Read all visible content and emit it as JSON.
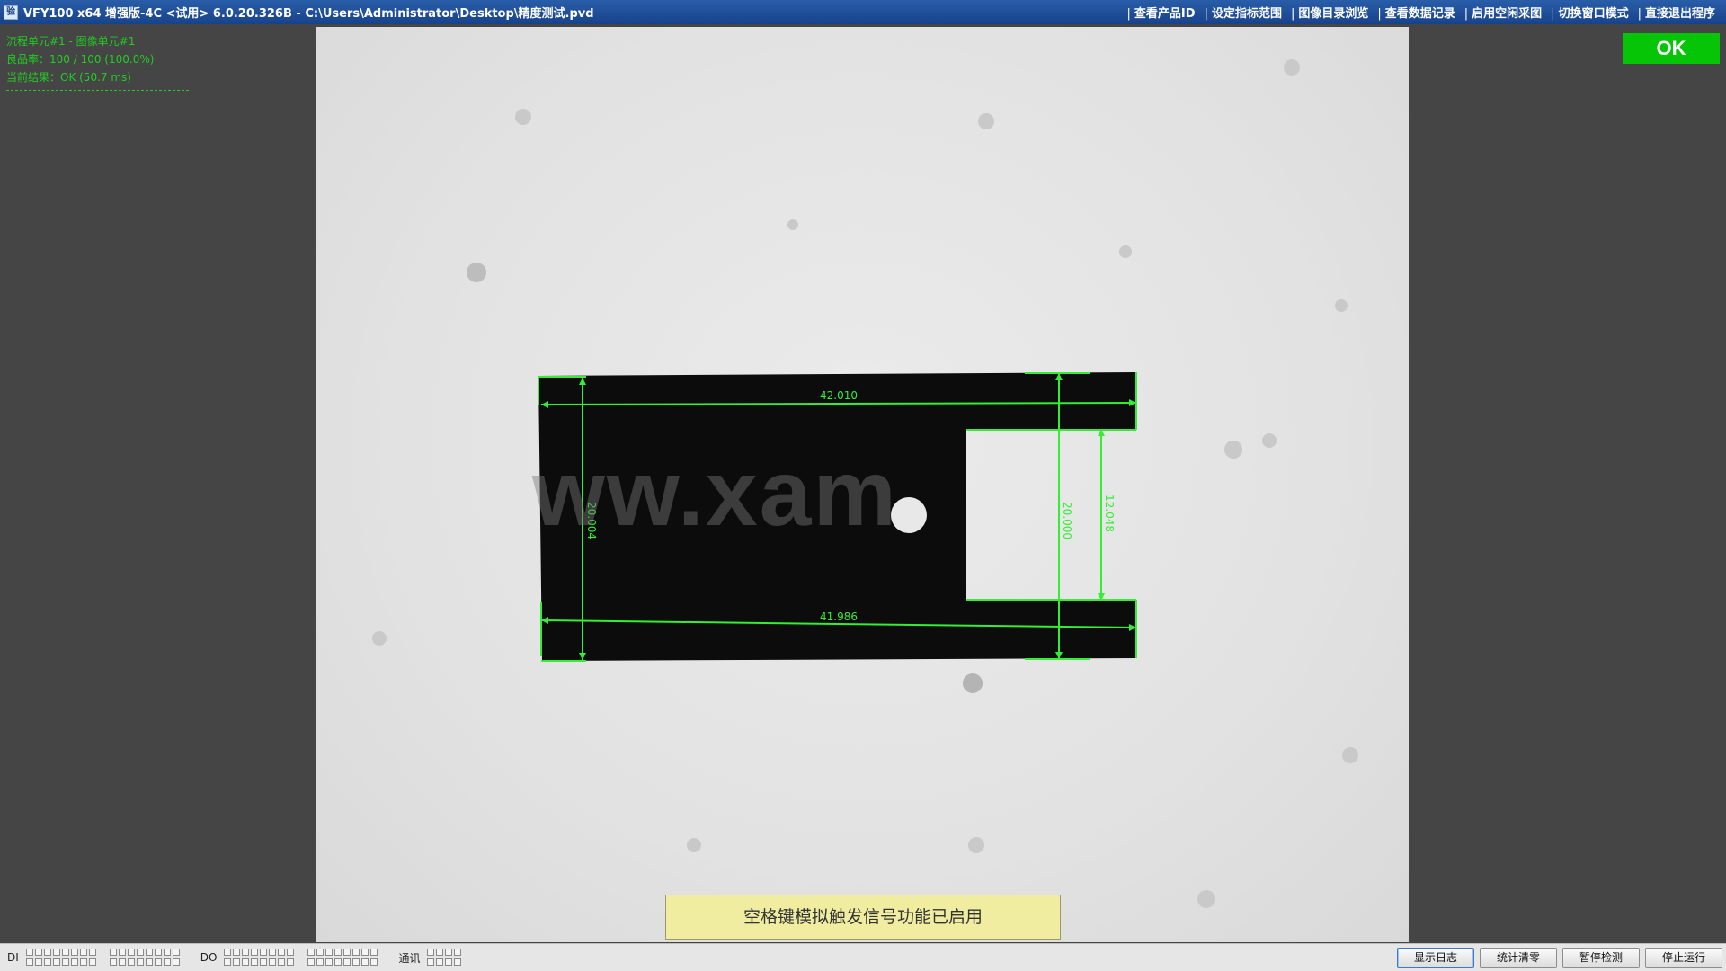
{
  "window": {
    "title": "VFY100 x64 增强版-4C <试用> 6.0.20.326B - C:\\Users\\Administrator\\Desktop\\精度测试.pvd",
    "icon_name": "app-icon",
    "icon_glyph": "验"
  },
  "menu": [
    {
      "label": "查看产品ID"
    },
    {
      "label": "设定指标范围"
    },
    {
      "label": "图像目录浏览"
    },
    {
      "label": "查看数据记录"
    },
    {
      "label": "启用空闲采图"
    },
    {
      "label": "切换窗口模式"
    },
    {
      "label": "直接退出程序"
    }
  ],
  "info": {
    "line1": "流程单元#1 - 图像单元#1",
    "line2": "良品率：100 / 100 (100.0%)",
    "line3": "当前结果：OK (50.7 ms)"
  },
  "result": {
    "label": "OK",
    "color": "#06c406"
  },
  "image": {
    "watermark": "ww.xam",
    "measurements": {
      "top_width": "42.010",
      "bottom_width": "41.986",
      "left_height": "20.004",
      "right_height": "20.000",
      "slot_height": "12.048"
    },
    "overlay_color": "#33ee33"
  },
  "notice": {
    "text": "空格键模拟触发信号功能已启用"
  },
  "statusbar": {
    "di_label": "DI",
    "do_label": "DO",
    "comm_label": "通讯",
    "buttons": [
      {
        "label": "显示日志"
      },
      {
        "label": "统计清零"
      },
      {
        "label": "暂停检测"
      },
      {
        "label": "停止运行"
      }
    ]
  }
}
